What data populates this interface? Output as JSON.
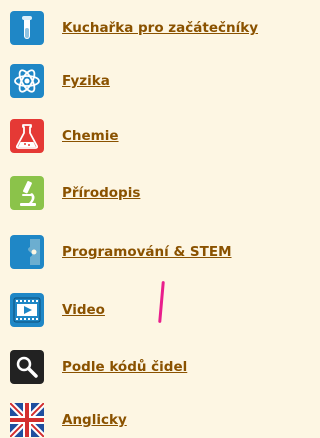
{
  "menu": {
    "items": [
      {
        "label": "Kuchařka pro začátečníky",
        "icon": "test-tube-icon",
        "color": "#1f87c6"
      },
      {
        "label": "Fyzika",
        "icon": "atom-icon",
        "color": "#1f87c6"
      },
      {
        "label": "Chemie",
        "icon": "flask-icon",
        "color": "#e53935"
      },
      {
        "label": "Přírodopis",
        "icon": "microscope-icon",
        "color": "#8bc34a"
      },
      {
        "label": "Programování & STEM",
        "icon": "puzzle-piece-icon",
        "color": "#1f87c6"
      },
      {
        "label": "Video",
        "icon": "film-play-icon",
        "color": "#1f87c6"
      },
      {
        "label": "Podle kódů čidel",
        "icon": "magnifier-icon",
        "color": "#222222"
      },
      {
        "label": "Anglicky",
        "icon": "uk-flag-icon",
        "color": "#1f4f9f"
      }
    ]
  },
  "annotation": {
    "color": "#e91e8c"
  }
}
